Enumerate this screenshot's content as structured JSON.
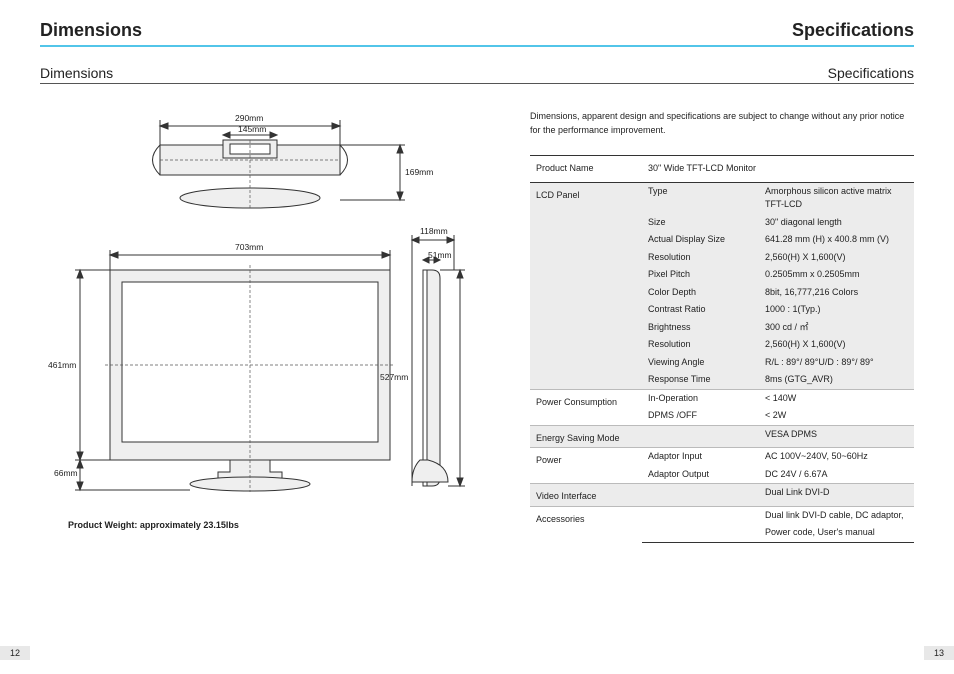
{
  "header": {
    "left": "Dimensions",
    "right": "Specifications"
  },
  "subheader": {
    "left": "Dimensions",
    "right": "Specifications"
  },
  "dims": {
    "top_width": "290mm",
    "top_inner": "145mm",
    "top_height": "169mm",
    "front_width": "703mm",
    "side_depth_top": "118mm",
    "side_depth_inner": "51mm",
    "front_height": "461mm",
    "side_height": "527mm",
    "stand_gap": "66mm"
  },
  "weight": "Product Weight: approximately 23.15lbs",
  "disclaimer": "Dimensions, apparent design and specifications are subject to change without any prior notice\nfor the performance improvement.",
  "spec": {
    "product_name_label": "Product Name",
    "product_name": "30\" Wide TFT-LCD Monitor",
    "sections": [
      {
        "cat": "LCD Panel",
        "shade": true,
        "rows": [
          {
            "attr": "Type",
            "val": "Amorphous silicon active matrix TFT-LCD"
          },
          {
            "attr": "Size",
            "val": "30\"  diagonal length"
          },
          {
            "attr": "Actual Display Size",
            "val": "641.28 mm (H) x 400.8 mm (V)"
          },
          {
            "attr": "Resolution",
            "val": "2,560(H) X 1,600(V)"
          },
          {
            "attr": "Pixel Pitch",
            "val": "0.2505mm x 0.2505mm"
          },
          {
            "attr": "Color Depth",
            "val": "8bit, 16,777,216 Colors"
          },
          {
            "attr": "Contrast Ratio",
            "val": "1000 : 1(Typ.)"
          },
          {
            "attr": "Brightness",
            "val": "300 cd / ㎡"
          },
          {
            "attr": "Resolution",
            "val": "2,560(H) X 1,600(V)"
          },
          {
            "attr": "Viewing Angle",
            "val": "R/L : 89°/ 89°U/D : 89°/ 89°"
          },
          {
            "attr": "Response Time",
            "val": "8ms (GTG_AVR)"
          }
        ]
      },
      {
        "cat": "Power Consumption",
        "shade": false,
        "rows": [
          {
            "attr": "In-Operation",
            "val": "< 140W"
          },
          {
            "attr": "DPMS /OFF",
            "val": "< 2W"
          }
        ]
      },
      {
        "cat": "Energy Saving Mode",
        "shade": true,
        "rows": [
          {
            "attr": "",
            "val": "VESA DPMS"
          }
        ]
      },
      {
        "cat": "Power",
        "shade": false,
        "rows": [
          {
            "attr": "Adaptor Input",
            "val": "AC 100V~240V, 50~60Hz"
          },
          {
            "attr": "Adaptor Output",
            "val": "DC 24V / 6.67A"
          }
        ]
      },
      {
        "cat": "Video Interface",
        "shade": true,
        "rows": [
          {
            "attr": "",
            "val": "Dual Link DVI-D"
          }
        ]
      },
      {
        "cat": "Accessories",
        "shade": false,
        "rows": [
          {
            "attr": "",
            "val": "Dual link DVI-D cable, DC adaptor,"
          },
          {
            "attr": "",
            "val": "Power code, User's manual"
          }
        ]
      }
    ]
  },
  "pages": {
    "left": "12",
    "right": "13"
  }
}
